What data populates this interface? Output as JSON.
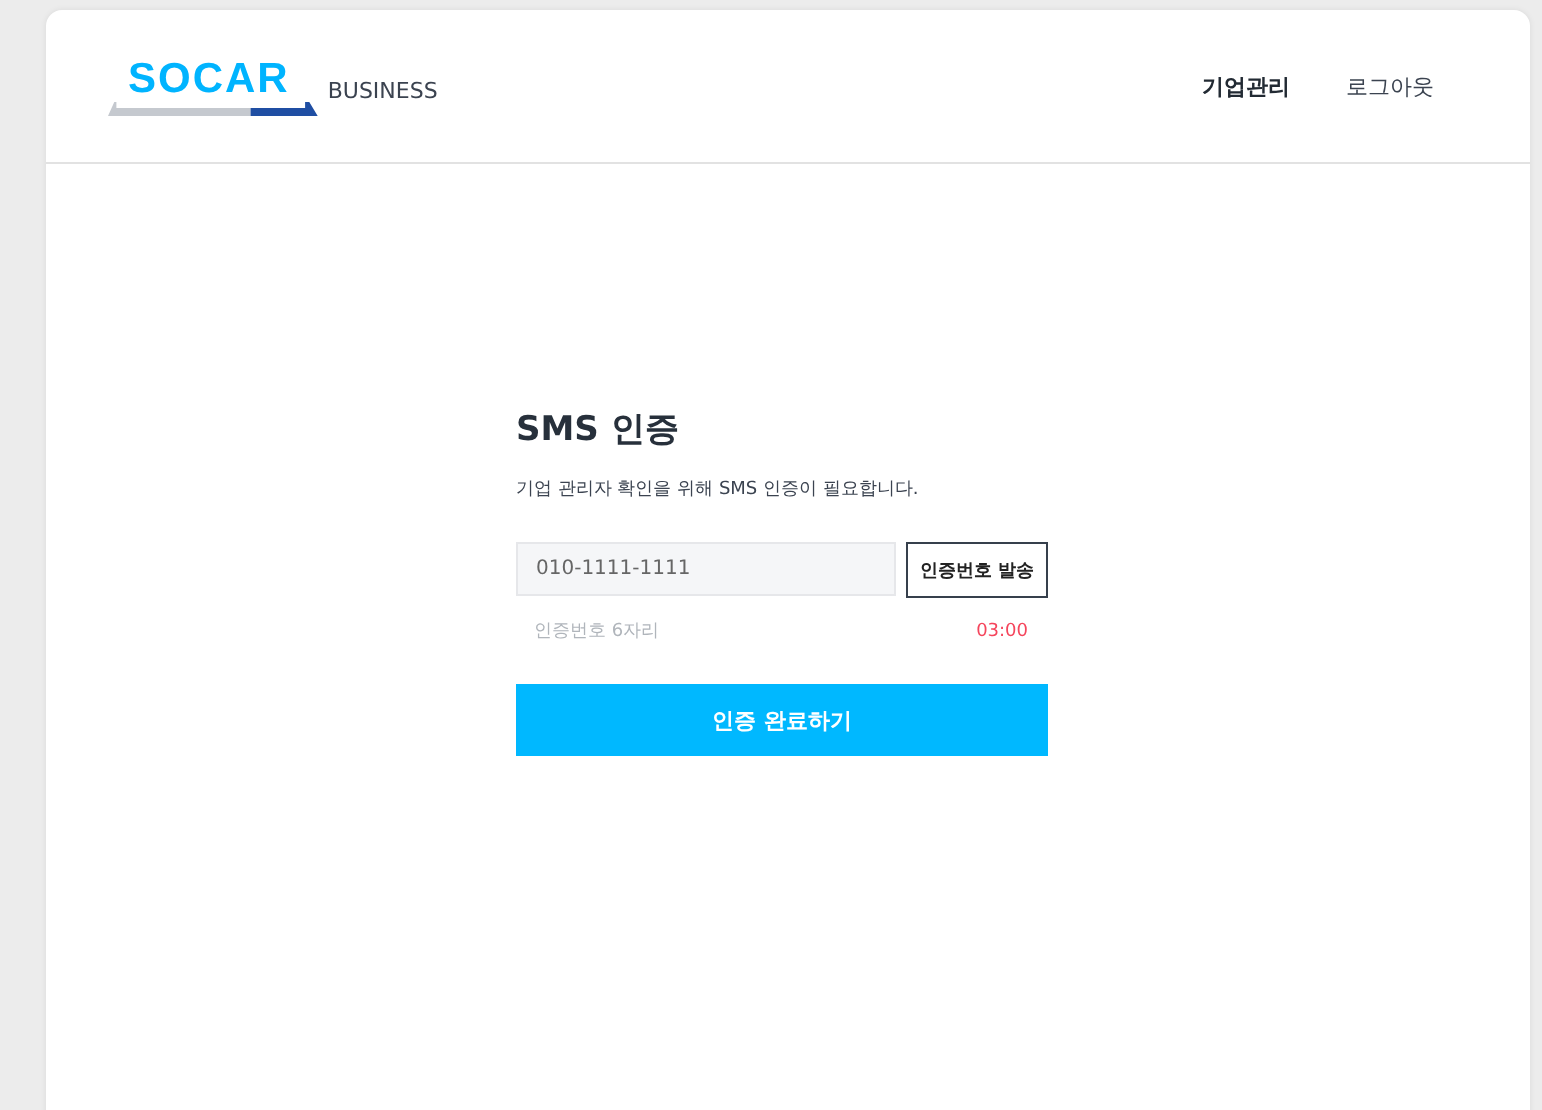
{
  "header": {
    "logo": {
      "brand": "SOCAR",
      "suffix": "BUSINESS"
    },
    "nav": [
      {
        "label": "기업관리",
        "selected": true
      },
      {
        "label": "로그아웃",
        "selected": false
      }
    ]
  },
  "form": {
    "title": "SMS 인증",
    "description": "기업 관리자 확인을 위해 SMS 인증이 필요합니다.",
    "phone": {
      "value": "010-1111-1111"
    },
    "send_button": "인증번호 발송",
    "code": {
      "placeholder": "인증번호 6자리",
      "timer": "03:00"
    },
    "submit_button": "인증 완료하기"
  }
}
